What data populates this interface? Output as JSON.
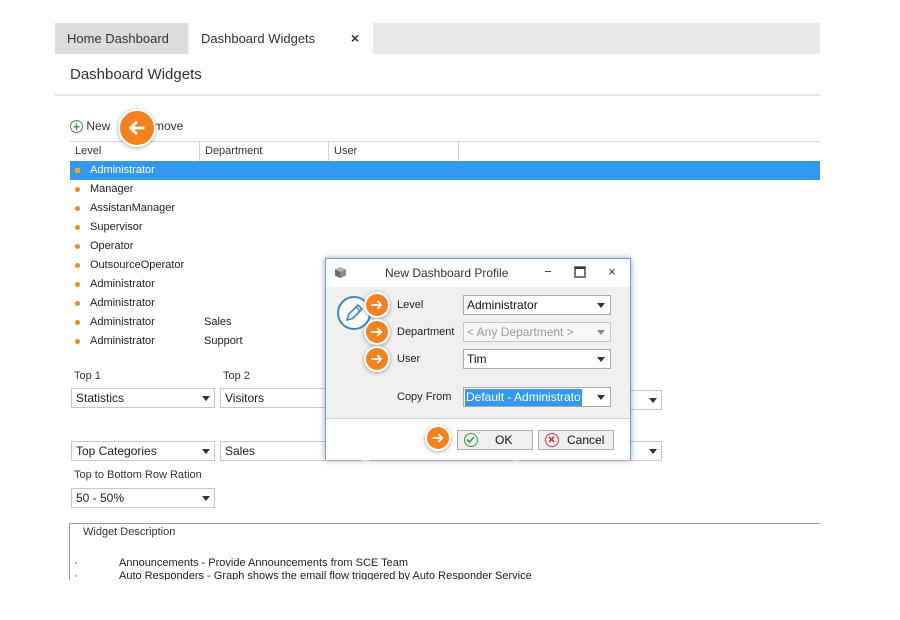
{
  "tabs": [
    {
      "label": "Home Dashboard"
    },
    {
      "label": "Dashboard Widgets",
      "close": "×"
    }
  ],
  "page_title": "Dashboard Widgets",
  "toolbar": {
    "new_label": "New",
    "remove_label": "move"
  },
  "grid": {
    "columns": [
      "Level",
      "Department",
      "User"
    ],
    "rows": [
      {
        "level": "Administrator",
        "department": "",
        "selected": true
      },
      {
        "level": "Manager",
        "department": ""
      },
      {
        "level": "AssistanManager",
        "department": ""
      },
      {
        "level": "Supervisor",
        "department": ""
      },
      {
        "level": "Operator",
        "department": ""
      },
      {
        "level": "OutsourceOperator",
        "department": ""
      },
      {
        "level": "Administrator",
        "department": ""
      },
      {
        "level": "Administrator",
        "department": ""
      },
      {
        "level": "Administrator",
        "department": "Sales"
      },
      {
        "level": "Administrator",
        "department": "Support"
      }
    ]
  },
  "widgets": {
    "top1_label": "Top 1",
    "top2_label": "Top 2",
    "top1_value": "Statistics",
    "top2_value": "Visitors",
    "bottom1_value": "Top Categories",
    "bottom2_value": "Sales",
    "ratio_label": "Top to Bottom Row Ration",
    "ratio_value": "50 - 50%"
  },
  "description": {
    "title": "Widget Description",
    "bullet": "·",
    "lines": [
      "Announcements - Provide Announcements from SCE Team",
      "Auto Responders - Graph shows the email flow triggered by Auto Responder Service"
    ]
  },
  "dialog": {
    "title": "New Dashboard Profile",
    "minimize": "−",
    "close": "×",
    "level_label": "Level",
    "level_value": "Administrator",
    "department_label": "Department",
    "department_value": "< Any Department >",
    "user_label": "User",
    "user_value": "Tim",
    "copy_label": "Copy From",
    "copy_value": "Default - Administrato",
    "ok_label": "OK",
    "cancel_label": "Cancel"
  },
  "colors": {
    "accent": "#3399ee",
    "callout": "#f5811f",
    "bullet": "#f08a24",
    "ok_green": "#3a9a3a",
    "cancel_red": "#d9363e"
  }
}
